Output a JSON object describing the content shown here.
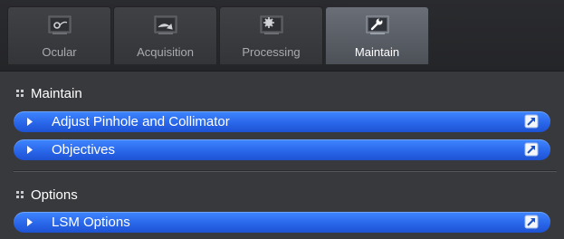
{
  "tabs": [
    {
      "label": "Ocular",
      "icon": "ocular-icon",
      "active": false
    },
    {
      "label": "Acquisition",
      "icon": "acquisition-icon",
      "active": false
    },
    {
      "label": "Processing",
      "icon": "processing-icon",
      "active": false
    },
    {
      "label": "Maintain",
      "icon": "wrench-icon",
      "active": true
    }
  ],
  "sections": {
    "maintain": {
      "title": "Maintain",
      "items": [
        {
          "label": "Adjust Pinhole and Collimator",
          "icon": "popout-icon"
        },
        {
          "label": "Objectives",
          "icon": "popout-icon"
        }
      ]
    },
    "options": {
      "title": "Options",
      "items": [
        {
          "label": "LSM Options",
          "icon": "popout-icon"
        }
      ]
    }
  },
  "colors": {
    "panel_background": "#38393d",
    "active_tab": "#5b6068",
    "pill_blue": "#2a67ea",
    "text": "#ffffff",
    "inactive_tab_text": "#a9abb0"
  }
}
